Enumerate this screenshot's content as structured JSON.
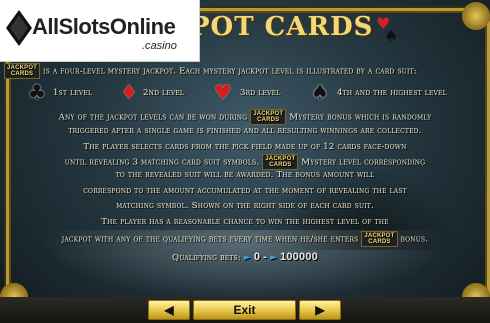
{
  "logo": {
    "brand": "AllSlotsOnline",
    "tld": ".casino"
  },
  "title": "POT CARDS",
  "intro": {
    "badge_line1": "JACKPOT",
    "badge_line2": "CARDS",
    "text": "is a four-level mystery jackpot. Each mystery jackpot level is illustrated by a card suit:"
  },
  "levels": [
    {
      "suit_icon": "club-icon",
      "label": "1st level"
    },
    {
      "suit_icon": "diamond-icon",
      "label": "2nd level"
    },
    {
      "suit_icon": "heart-icon",
      "label": "3rd level"
    },
    {
      "suit_icon": "spade-icon",
      "label": "4th and the highest level"
    }
  ],
  "paragraph": {
    "l1a": "Any of the jackpot levels can be won during",
    "l1b": "Mystery bonus which is randomly",
    "l2": "triggered after a single game is finished and all resulting winnings are collected.",
    "l3": "The player selects cards from the pick field made up of 12 cards face-down",
    "l4a": "until revealing 3 matching card suit symbols.",
    "l4b": "Mystery level corresponding",
    "l5": "to the revealed suit will be awarded. The bonus amount will",
    "l6": "correspond to the amount accumulated at the moment of revealing the last",
    "l7": "matching symbol. Shown on the right side of each card suit.",
    "l8": "The player has a reasonable chance to win the highest level of the",
    "l9a": "jackpot with any of the qualifying bets every time when he/she enters",
    "l9b": "bonus."
  },
  "bets": {
    "label": "Qualifying bets:",
    "min": "0",
    "separator": "-",
    "max": "100000"
  },
  "nav": {
    "prev": "◀",
    "exit": "Exit",
    "next": "▶"
  },
  "colors": {
    "gold": "#e7c544",
    "text": "#f4ead0",
    "red_suit": "#d41d1d"
  }
}
